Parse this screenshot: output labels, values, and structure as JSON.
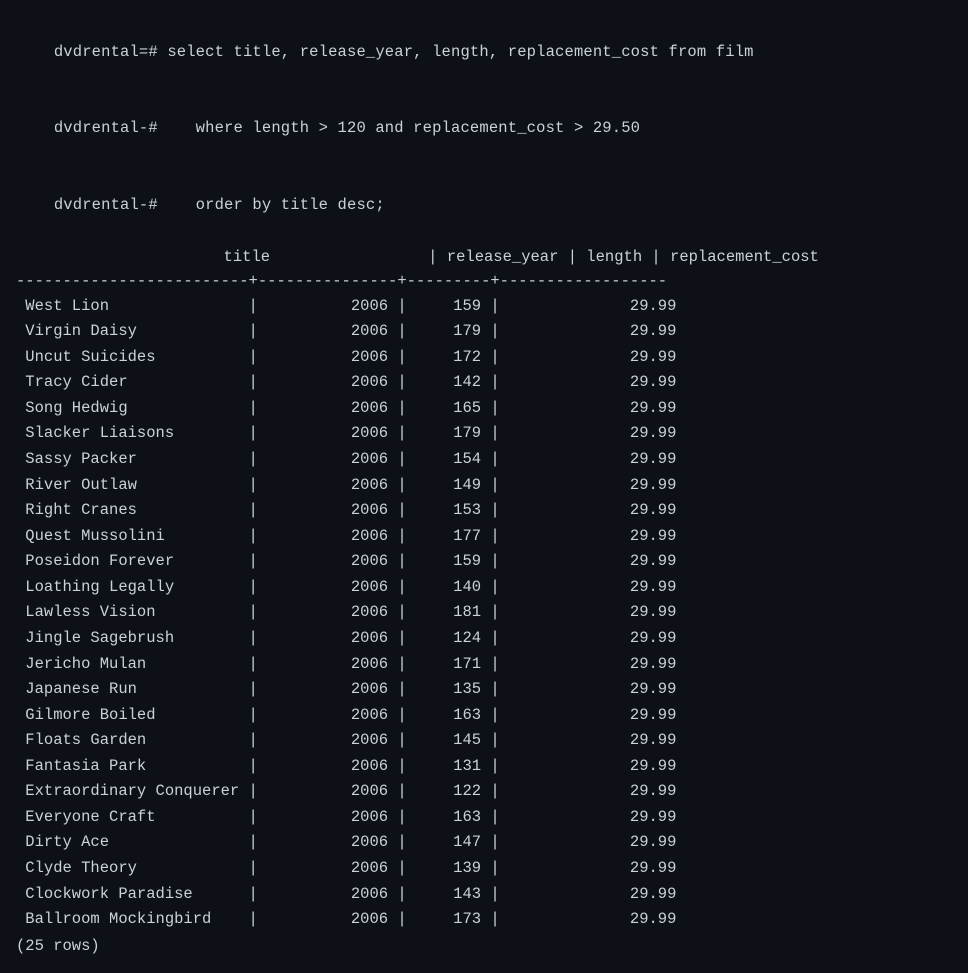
{
  "terminal": {
    "prompts": [
      {
        "prefix": "dvdrental=# ",
        "text": "select title, release_year, length, replacement_cost from film"
      },
      {
        "prefix": "dvdrental-# ",
        "text": "   where length > 120 and replacement_cost > 29.50"
      },
      {
        "prefix": "dvdrental-# ",
        "text": "   order by title desc;"
      }
    ],
    "columns": {
      "headers": [
        "title",
        "release_year",
        "length",
        "replacement_cost"
      ],
      "separator": "-------------------------+---------------+---------+------------------"
    },
    "rows": [
      {
        "title": "West Lion",
        "release_year": "2006",
        "length": "159",
        "replacement_cost": "29.99"
      },
      {
        "title": "Virgin Daisy",
        "release_year": "2006",
        "length": "179",
        "replacement_cost": "29.99"
      },
      {
        "title": "Uncut Suicides",
        "release_year": "2006",
        "length": "172",
        "replacement_cost": "29.99"
      },
      {
        "title": "Tracy Cider",
        "release_year": "2006",
        "length": "142",
        "replacement_cost": "29.99"
      },
      {
        "title": "Song Hedwig",
        "release_year": "2006",
        "length": "165",
        "replacement_cost": "29.99"
      },
      {
        "title": "Slacker Liaisons",
        "release_year": "2006",
        "length": "179",
        "replacement_cost": "29.99"
      },
      {
        "title": "Sassy Packer",
        "release_year": "2006",
        "length": "154",
        "replacement_cost": "29.99"
      },
      {
        "title": "River Outlaw",
        "release_year": "2006",
        "length": "149",
        "replacement_cost": "29.99"
      },
      {
        "title": "Right Cranes",
        "release_year": "2006",
        "length": "153",
        "replacement_cost": "29.99"
      },
      {
        "title": "Quest Mussolini",
        "release_year": "2006",
        "length": "177",
        "replacement_cost": "29.99"
      },
      {
        "title": "Poseidon Forever",
        "release_year": "2006",
        "length": "159",
        "replacement_cost": "29.99"
      },
      {
        "title": "Loathing Legally",
        "release_year": "2006",
        "length": "140",
        "replacement_cost": "29.99"
      },
      {
        "title": "Lawless Vision",
        "release_year": "2006",
        "length": "181",
        "replacement_cost": "29.99"
      },
      {
        "title": "Jingle Sagebrush",
        "release_year": "2006",
        "length": "124",
        "replacement_cost": "29.99"
      },
      {
        "title": "Jericho Mulan",
        "release_year": "2006",
        "length": "171",
        "replacement_cost": "29.99"
      },
      {
        "title": "Japanese Run",
        "release_year": "2006",
        "length": "135",
        "replacement_cost": "29.99"
      },
      {
        "title": "Gilmore Boiled",
        "release_year": "2006",
        "length": "163",
        "replacement_cost": "29.99"
      },
      {
        "title": "Floats Garden",
        "release_year": "2006",
        "length": "145",
        "replacement_cost": "29.99"
      },
      {
        "title": "Fantasia Park",
        "release_year": "2006",
        "length": "131",
        "replacement_cost": "29.99"
      },
      {
        "title": "Extraordinary Conquerer",
        "release_year": "2006",
        "length": "122",
        "replacement_cost": "29.99"
      },
      {
        "title": "Everyone Craft",
        "release_year": "2006",
        "length": "163",
        "replacement_cost": "29.99"
      },
      {
        "title": "Dirty Ace",
        "release_year": "2006",
        "length": "147",
        "replacement_cost": "29.99"
      },
      {
        "title": "Clyde Theory",
        "release_year": "2006",
        "length": "139",
        "replacement_cost": "29.99"
      },
      {
        "title": "Clockwork Paradise",
        "release_year": "2006",
        "length": "143",
        "replacement_cost": "29.99"
      },
      {
        "title": "Ballroom Mockingbird",
        "release_year": "2006",
        "length": "173",
        "replacement_cost": "29.99"
      }
    ],
    "footer": "(25 rows)"
  }
}
